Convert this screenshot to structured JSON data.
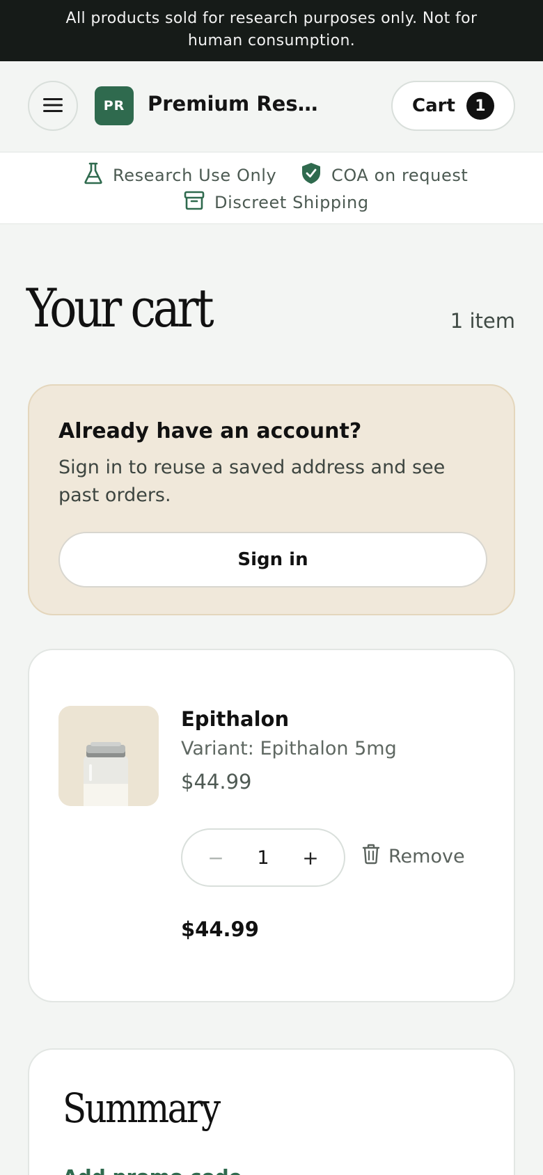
{
  "announcement": "All products sold for research purposes only. Not for human consumption.",
  "header": {
    "logo_initials": "PR",
    "brand": "Premium Resear...",
    "cart_label": "Cart",
    "cart_count": "1"
  },
  "trust": {
    "item1": "Research Use Only",
    "item2": "COA on request",
    "item3": "Discreet Shipping"
  },
  "page": {
    "title": "Your cart",
    "item_count": "1 item"
  },
  "signin": {
    "title": "Already have an account?",
    "description": "Sign in to reuse a saved address and see past orders.",
    "button": "Sign in"
  },
  "cart_item": {
    "name": "Epithalon",
    "variant": "Variant: Epithalon 5mg",
    "price": "$44.99",
    "quantity": "1",
    "minus": "−",
    "plus": "+",
    "remove": "Remove",
    "line_total": "$44.99"
  },
  "summary": {
    "title": "Summary",
    "partial_link": "Add promo code"
  },
  "colors": {
    "accent": "#2f6a4e",
    "announcement_bg": "#161b18",
    "signin_bg": "#f0e8da"
  }
}
